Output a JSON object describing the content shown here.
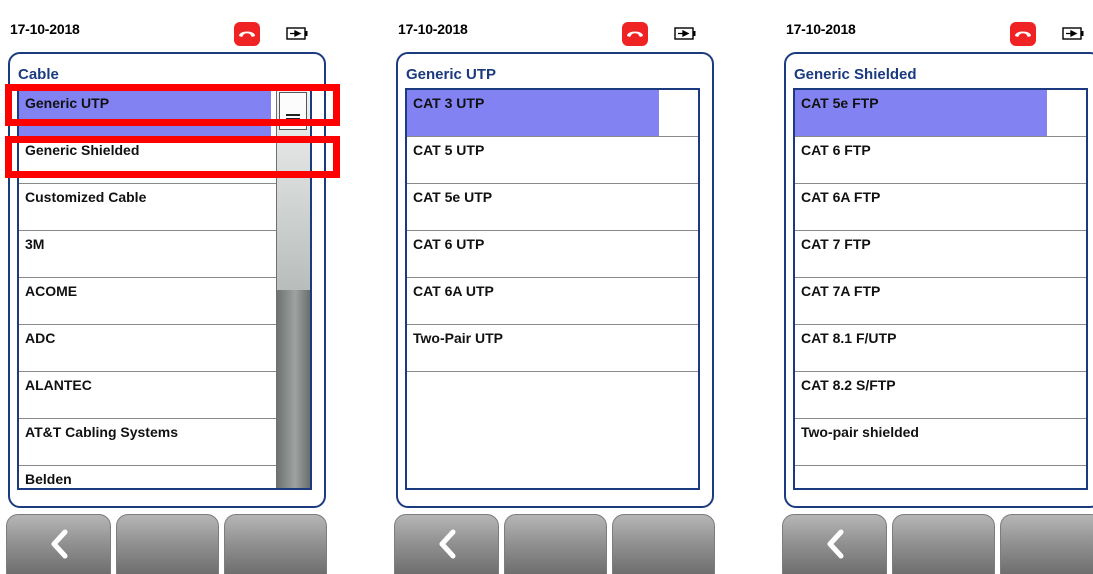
{
  "colors": {
    "accent": "#1b3a80",
    "selection": "#8282f2",
    "hangup": "#ef2323",
    "highlight_box": "#ff0000"
  },
  "screens": [
    {
      "date": "17-10-2018",
      "title": "Cable",
      "items": [
        {
          "label": "Generic UTP",
          "selected": true
        },
        {
          "label": "Generic Shielded"
        },
        {
          "label": "Customized Cable"
        },
        {
          "label": "3M"
        },
        {
          "label": "ACOME"
        },
        {
          "label": "ADC"
        },
        {
          "label": "ALANTEC"
        },
        {
          "label": "AT&T Cabling Systems"
        },
        {
          "label": "Belden"
        }
      ],
      "scrollbar": true,
      "footer_icons": [
        "back-chevron-icon",
        "",
        ""
      ]
    },
    {
      "date": "17-10-2018",
      "title": "Generic UTP",
      "items": [
        {
          "label": "CAT 3 UTP",
          "selected": true
        },
        {
          "label": "CAT 5 UTP"
        },
        {
          "label": "CAT 5e UTP"
        },
        {
          "label": "CAT 6 UTP"
        },
        {
          "label": "CAT 6A UTP"
        },
        {
          "label": "Two-Pair UTP"
        },
        {
          "label": ""
        },
        {
          "label": ""
        }
      ],
      "scrollbar": false,
      "footer_icons": [
        "back-chevron-icon",
        "",
        ""
      ]
    },
    {
      "date": "17-10-2018",
      "title": "Generic Shielded",
      "items": [
        {
          "label": "CAT 5e FTP",
          "selected": true
        },
        {
          "label": "CAT 6 FTP"
        },
        {
          "label": "CAT 6A FTP"
        },
        {
          "label": "CAT 7 FTP"
        },
        {
          "label": "CAT 7A FTP"
        },
        {
          "label": "CAT 8.1 F/UTP"
        },
        {
          "label": "CAT 8.2 S/FTP"
        },
        {
          "label": "Two-pair shielded"
        },
        {
          "label": ""
        }
      ],
      "scrollbar": false,
      "footer_icons": [
        "back-chevron-icon",
        "",
        ""
      ]
    }
  ]
}
